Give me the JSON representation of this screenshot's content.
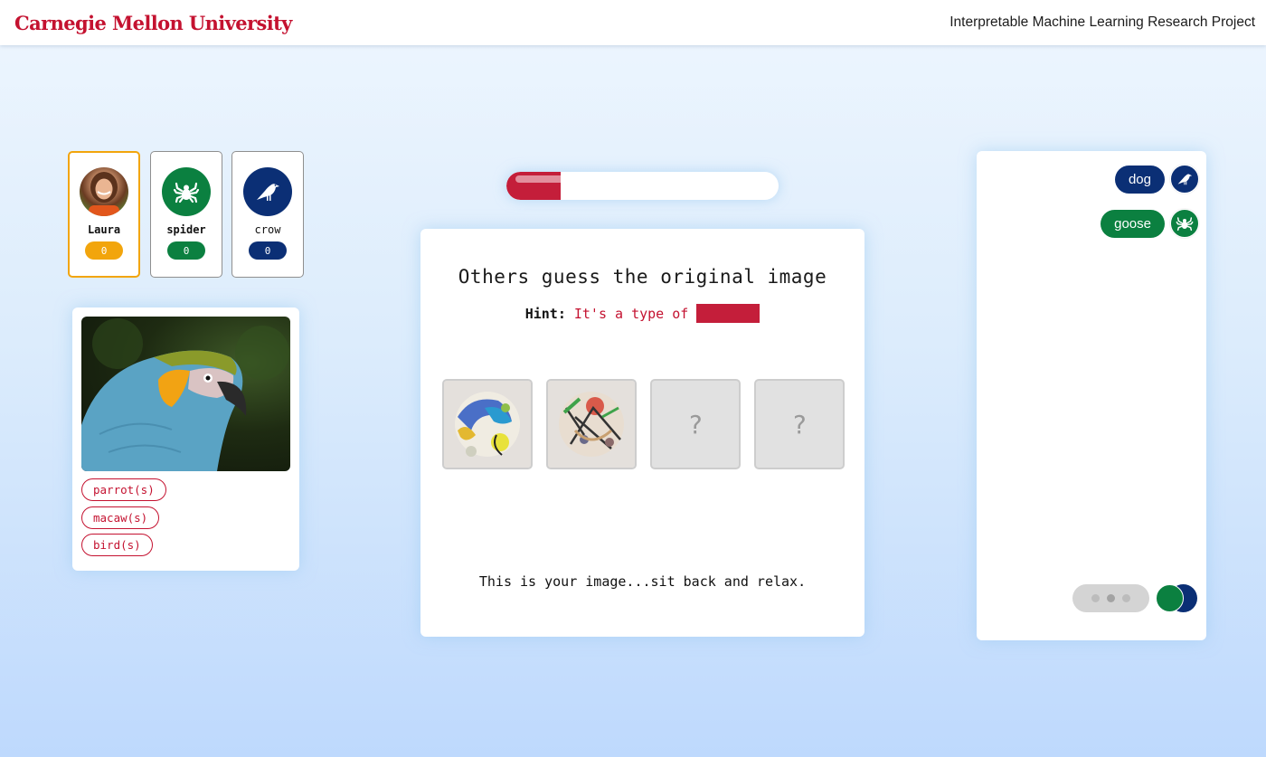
{
  "header": {
    "brand": "Carnegie Mellon University",
    "project_title": "Interpretable Machine Learning Research Project"
  },
  "players": [
    {
      "name": "Laura",
      "score": "0",
      "avatar": "photo-avatar",
      "color": "#f2a50c",
      "active": true
    },
    {
      "name": "spider",
      "score": "0",
      "avatar": "spider-icon",
      "color": "#0b8040",
      "active": false
    },
    {
      "name": "crow",
      "score": "0",
      "avatar": "crow-icon",
      "color": "#0b2f75",
      "active": false
    }
  ],
  "image_card": {
    "image_subject": "parrot photo",
    "labels": [
      "parrot(s)",
      "macaw(s)",
      "bird(s)"
    ]
  },
  "progress": {
    "value_percent": 20,
    "color": "#c41e3a"
  },
  "game": {
    "title": "Others guess the original image",
    "hint_label": "Hint:",
    "hint_text": "It's a type of",
    "thumbnails": [
      {
        "state": "revealed",
        "subject": "generated-bird-image"
      },
      {
        "state": "revealed",
        "subject": "generated-abstract-image"
      },
      {
        "state": "hidden",
        "placeholder": "?"
      },
      {
        "state": "hidden",
        "placeholder": "?"
      }
    ],
    "footer": "This is your image...sit back and relax."
  },
  "chat": {
    "messages": [
      {
        "text": "dog",
        "sender": "crow",
        "sender_icon": "crow-icon",
        "color": "#0b2f75"
      },
      {
        "text": "goose",
        "sender": "spider",
        "sender_icon": "spider-icon",
        "color": "#0b8040"
      }
    ],
    "typing_indicator": true,
    "typing_users": [
      "spider",
      "crow"
    ]
  },
  "colors": {
    "brand_red": "#c41230",
    "gold": "#f2a50c",
    "green": "#0b8040",
    "navy": "#0b2f75"
  }
}
